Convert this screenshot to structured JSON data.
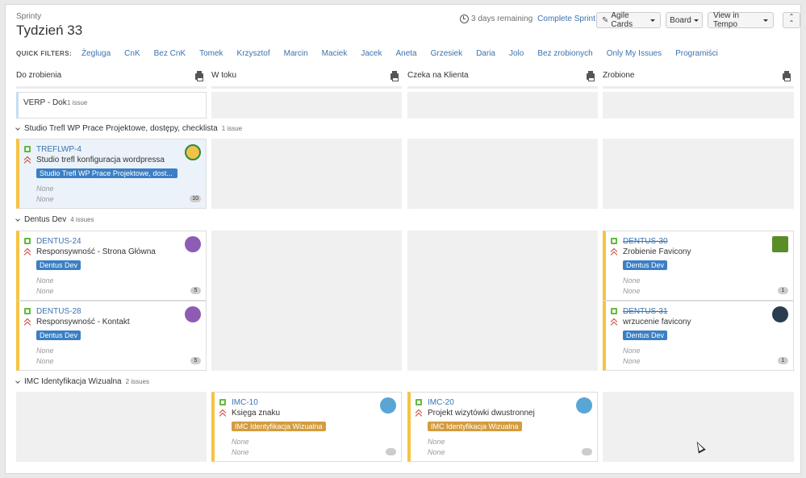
{
  "header": {
    "breadcrumb": "Sprinty",
    "title": "Tydzień 33",
    "remaining": "3 days remaining",
    "complete_sprint": "Complete Sprint",
    "buttons": {
      "agile_cards": "Agile Cards",
      "board": "Board",
      "view_in_tempo": "View in Tempo"
    }
  },
  "quick_filters": {
    "label": "QUICK FILTERS:",
    "items": [
      "Żegluga",
      "CnK",
      "Bez CnK",
      "Tomek",
      "Krzysztof",
      "Marcin",
      "Maciek",
      "Jacek",
      "Aneta",
      "Grzesiek",
      "Daria",
      "Jolo",
      "Bez zrobionych",
      "Only My Issues",
      "Programiści"
    ]
  },
  "columns": [
    "Do zrobienia",
    "W toku",
    "Czeka na Klienta",
    "Zrobione"
  ],
  "swimlanes": {
    "verp": {
      "name": "VERP - Dok",
      "count": "1 issue"
    },
    "trefl": {
      "name": "Studio Trefl WP Prace Projektowe, dostępy, checklista",
      "count": "1 issue"
    },
    "dentus": {
      "name": "Dentus Dev",
      "count": "4 issues"
    },
    "imc": {
      "name": "IMC Identyfikacja Wizualna",
      "count": "2 issues"
    }
  },
  "cards": {
    "treflwp4": {
      "key": "TREFLWP-4",
      "summary": "Studio trefl konfiguracja wordpressa",
      "epic": "Studio Trefl WP Prace Projektowe, dost...",
      "field1": "None",
      "field2": "None",
      "badge": "10"
    },
    "dentus24": {
      "key": "DENTUS-24",
      "summary": "Responsywność - Strona Główna",
      "epic": "Dentus Dev",
      "field1": "None",
      "field2": "None",
      "badge": "5"
    },
    "dentus28": {
      "key": "DENTUS-28",
      "summary": "Responsywność - Kontakt",
      "epic": "Dentus Dev",
      "field1": "None",
      "field2": "None",
      "badge": "5"
    },
    "dentus30": {
      "key": "DENTUS-30",
      "summary": "Zrobienie Favicony",
      "epic": "Dentus Dev",
      "field1": "None",
      "field2": "None",
      "badge": "1"
    },
    "dentus31": {
      "key": "DENTUS-31",
      "summary": "wrzucenie favicony",
      "epic": "Dentus Dev",
      "field1": "None",
      "field2": "None",
      "badge": "1"
    },
    "imc10": {
      "key": "IMC-10",
      "summary": "Księga znaku",
      "epic": "IMC Identyfikacja Wizualna",
      "field1": "None",
      "field2": "None",
      "badge": ""
    },
    "imc20": {
      "key": "IMC-20",
      "summary": "Projekt wizytówki dwustronnej",
      "epic": "IMC Identyfikacja Wizualna",
      "field1": "None",
      "field2": "None",
      "badge": ""
    }
  },
  "colors": {
    "link": "#3b73af",
    "epic_blue": "#3b7fc4",
    "epic_orange": "#d39c3f",
    "card_border": "#f6c342",
    "story": "#63ba3c",
    "priority": "#d04437"
  }
}
